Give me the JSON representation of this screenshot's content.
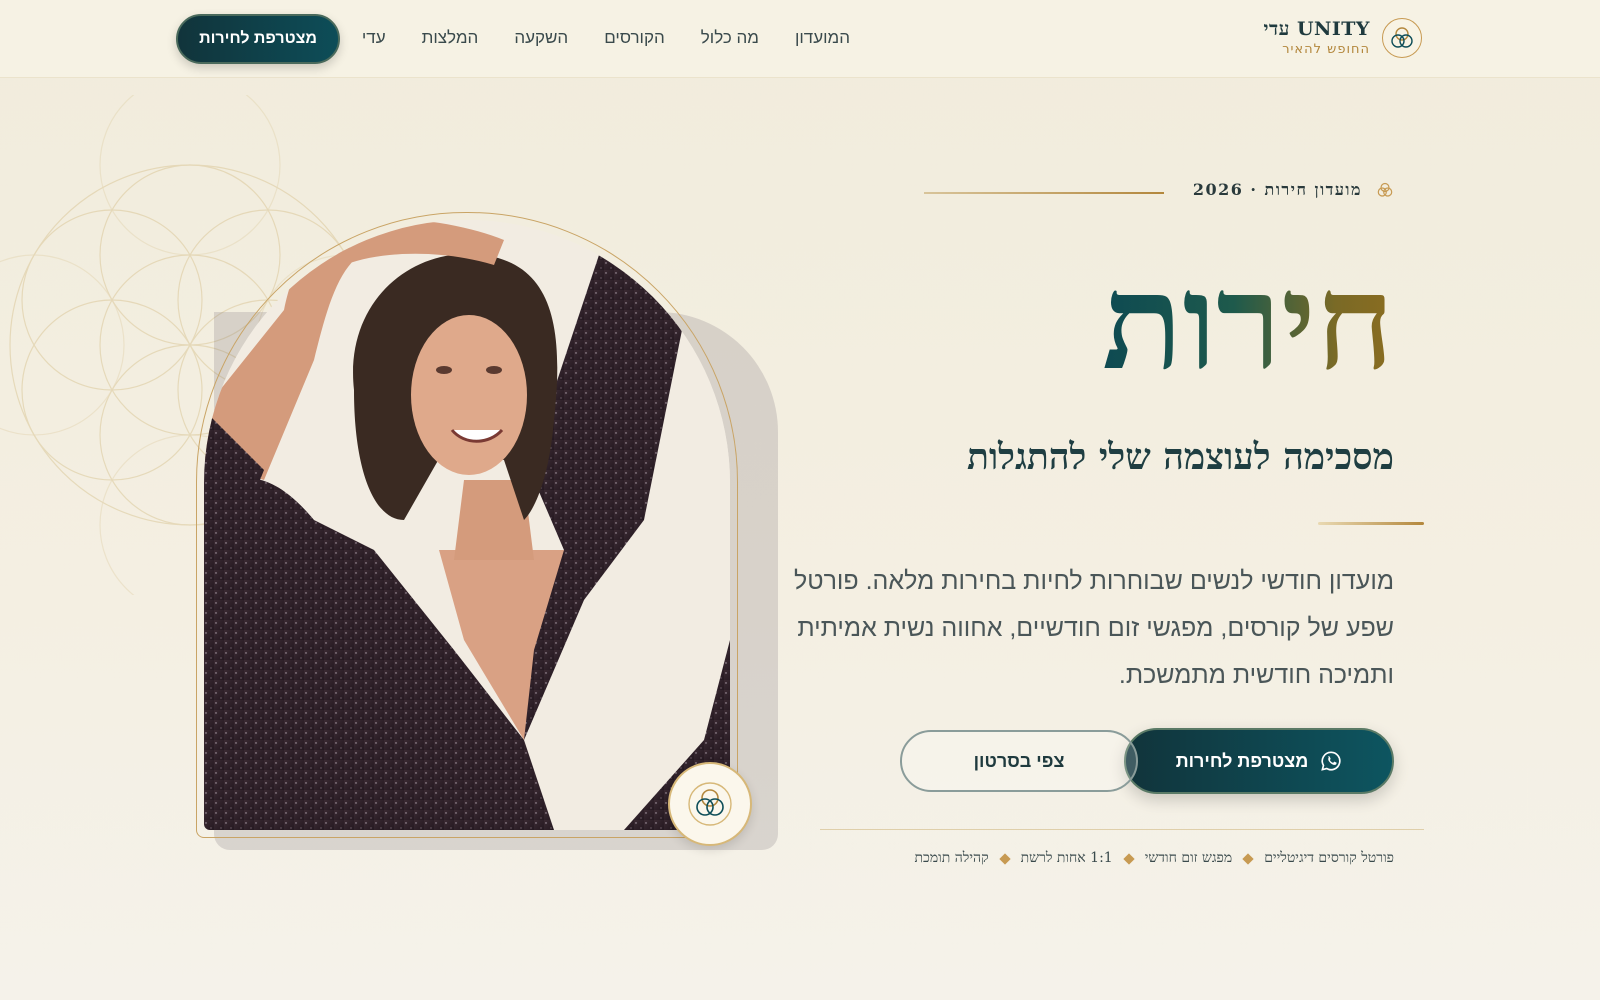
{
  "header": {
    "brand_name": "UNITY עדי",
    "brand_tagline": "החופש להאיר",
    "nav": [
      "המועדון",
      "מה כלול",
      "הקורסים",
      "השקעה",
      "המלצות",
      "עדי"
    ],
    "cta_label": "מצטרפת לחירות"
  },
  "hero": {
    "eyebrow": "מועדון חירות · 2026",
    "title": "חירות",
    "subtitle": "מסכימה לעוצמה שלי להתגלות",
    "body": "מועדון חודשי לנשים שבוחרות לחיות בחירות מלאה. פורטל שפע של קורסים, מפגשי זום חודשיים, אחווה נשית אמיתית ותמיכה חודשית מתמשכת.",
    "primary_button": "מצטרפת לחירות",
    "secondary_button": "צפי בסרטון",
    "features": [
      "פורטל קורסים דיגיטליים",
      "מפגש זום חודשי",
      "1:1 אחות לרשת",
      "קהילה תומכת"
    ]
  },
  "icons": {
    "brand_logo": "unity-logo-icon",
    "whatsapp": "whatsapp-icon",
    "photo_badge": "unity-logo-icon"
  },
  "colors": {
    "primary": "#0d4d58",
    "accent": "#b3873c",
    "background": "#f3eedf"
  }
}
